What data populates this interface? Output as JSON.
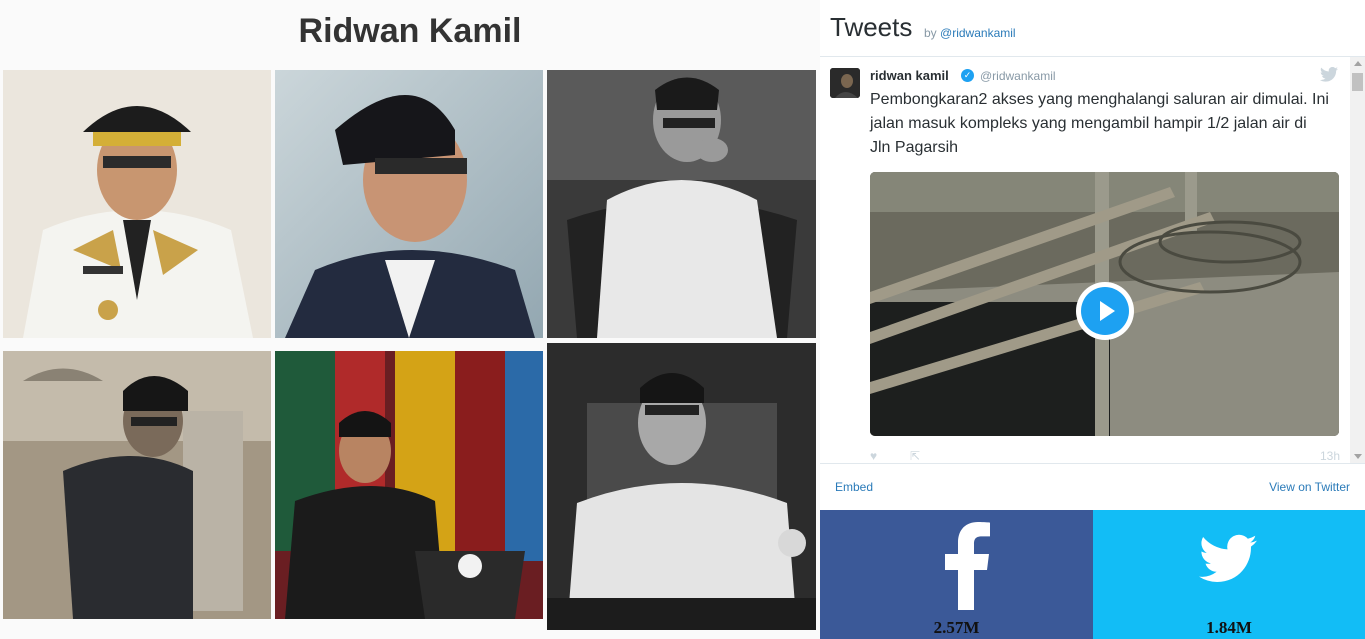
{
  "page": {
    "title": "Ridwan Kamil"
  },
  "gallery": {
    "photos": [
      {
        "name": "photo-official-uniform"
      },
      {
        "name": "photo-peci-portrait"
      },
      {
        "name": "photo-seated-bw"
      },
      {
        "name": "photo-walking-sepia"
      },
      {
        "name": "photo-podium-speech"
      },
      {
        "name": "photo-seated-smiling-bw"
      }
    ]
  },
  "twitter_widget": {
    "title": "Tweets",
    "by_prefix": "by",
    "by_handle": "@ridwankamil",
    "tweet": {
      "author_name": "ridwan kamil",
      "author_handle": "@ridwankamil",
      "text": "Pembongkaran2 akses yang menghalangi saluran air dimulai. Ini jalan masuk kompleks yang mengambil hampir 1/2 jalan air di Jln Pagarsih",
      "time": "13h",
      "media_type": "video"
    },
    "footer": {
      "embed_label": "Embed",
      "view_label": "View on Twitter"
    }
  },
  "social": {
    "facebook": {
      "count": "2.57M",
      "color": "#3b5998"
    },
    "twitter": {
      "count": "1.84M",
      "color": "#12bdf6"
    }
  }
}
